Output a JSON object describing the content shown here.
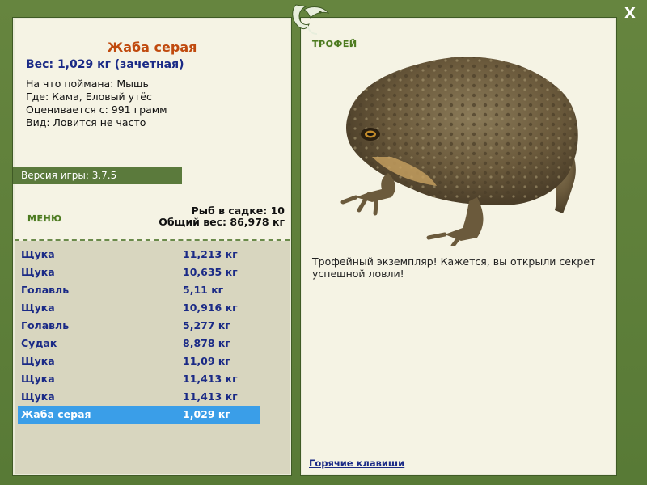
{
  "window": {
    "close_label": "X"
  },
  "fish": {
    "title": "Жаба серая",
    "weight_line": "Вес: 1,029 кг (зачетная)",
    "info": [
      "На что поймана: Мышь",
      "Где: Кама, Еловый утёс",
      "Оценивается с: 991 грамм",
      "Вид: Ловится не часто"
    ]
  },
  "version": "Версия игры: 3.7.5",
  "menu_label": "МЕНЮ",
  "keep": {
    "count_line": "Рыб в садке: 10",
    "total_line": "Общий вес: 86,978 кг"
  },
  "catch_list": [
    {
      "name": "Щука",
      "weight": "11,213 кг"
    },
    {
      "name": "Щука",
      "weight": "10,635 кг"
    },
    {
      "name": "Голавль",
      "weight": "5,11 кг"
    },
    {
      "name": "Щука",
      "weight": "10,916 кг"
    },
    {
      "name": "Голавль",
      "weight": "5,277 кг"
    },
    {
      "name": "Судак",
      "weight": "8,878 кг"
    },
    {
      "name": "Щука",
      "weight": "11,09 кг"
    },
    {
      "name": "Щука",
      "weight": "11,413 кг"
    },
    {
      "name": "Щука",
      "weight": "11,413 кг"
    },
    {
      "name": "Жаба серая",
      "weight": "1,029 кг",
      "selected": true
    }
  ],
  "trophy": {
    "label": "ТРОФЕЙ",
    "text": "Трофейный экземпляр! Кажется, вы открыли секрет успешной ловли!"
  },
  "hotkeys_label": "Горячие клавиши",
  "colors": {
    "frame": "#5b7a3c",
    "panel": "#f5f3e4",
    "list_bg": "#d8d6bf",
    "accent_title": "#c04a0e",
    "text_blue": "#1a2a86",
    "selection": "#3a9ee8"
  },
  "icons": {
    "logo": "fish-logo-icon",
    "close": "close-icon"
  }
}
